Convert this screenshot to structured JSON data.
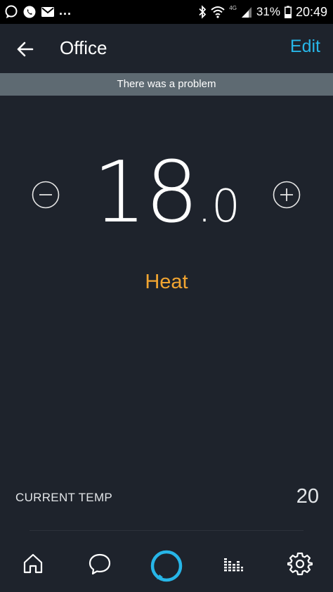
{
  "status_bar": {
    "left_overflow": "...",
    "network": "4G",
    "battery": "31%",
    "time": "20:49"
  },
  "header": {
    "title": "Office",
    "edit_label": "Edit"
  },
  "banner": {
    "message": "There was a problem"
  },
  "thermostat": {
    "setpoint_integer": "18",
    "setpoint_decimal": ".0",
    "mode": "Heat"
  },
  "current_temp": {
    "label": "CURRENT TEMP",
    "value": "20"
  },
  "bottom_nav": {
    "items": [
      "home-icon",
      "communicate-icon",
      "alexa-icon",
      "play-icon",
      "settings-icon"
    ]
  },
  "colors": {
    "background": "#1e232c",
    "accent": "#27b6e8",
    "mode": "#f2a531",
    "banner": "#5e6a72"
  }
}
